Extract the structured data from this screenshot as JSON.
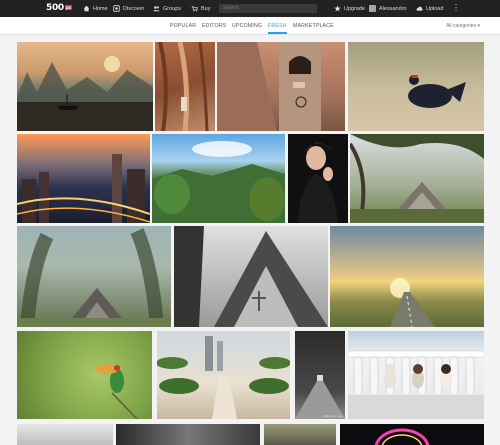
{
  "brand": {
    "logo_text": "500",
    "logo_badge": "px"
  },
  "topbar": {
    "nav": [
      {
        "label": "Home",
        "icon": "home-icon"
      },
      {
        "label": "Discover",
        "icon": "discover-icon"
      },
      {
        "label": "Groups",
        "icon": "groups-icon"
      },
      {
        "label": "Buy",
        "icon": "cart-icon"
      }
    ],
    "search_placeholder": "Search",
    "upgrade_label": "Upgrade",
    "user_name": "Alessandro",
    "upload_label": "Upload"
  },
  "subnav": {
    "tabs": [
      {
        "label": "POPULAR",
        "active": false
      },
      {
        "label": "EDITORS",
        "active": false
      },
      {
        "label": "UPCOMING",
        "active": false
      },
      {
        "label": "FRESH",
        "active": true
      },
      {
        "label": "MARKETPLACE",
        "active": false
      }
    ],
    "category_label": "All categories ▾"
  },
  "colors": {
    "accent": "#22a7d8",
    "topbar": "#222222",
    "page_bg": "#f3f3f3"
  },
  "photos": [
    {
      "name": "misty-river-fishermen"
    },
    {
      "name": "sandstone-canyon"
    },
    {
      "name": "mountain-bell-tower"
    },
    {
      "name": "black-grouse"
    },
    {
      "name": "city-night-skyline"
    },
    {
      "name": "forest-valley"
    },
    {
      "name": "woman-portrait"
    },
    {
      "name": "triangular-chapel-tree"
    },
    {
      "name": "chapel-tall-trees"
    },
    {
      "name": "chapel-black-white"
    },
    {
      "name": "sunset-road"
    },
    {
      "name": "bee-eater-bird"
    },
    {
      "name": "garden-path-towers"
    },
    {
      "name": "dark-corridor",
      "caption": "gallerydot.com"
    },
    {
      "name": "dogs-balcony"
    }
  ]
}
